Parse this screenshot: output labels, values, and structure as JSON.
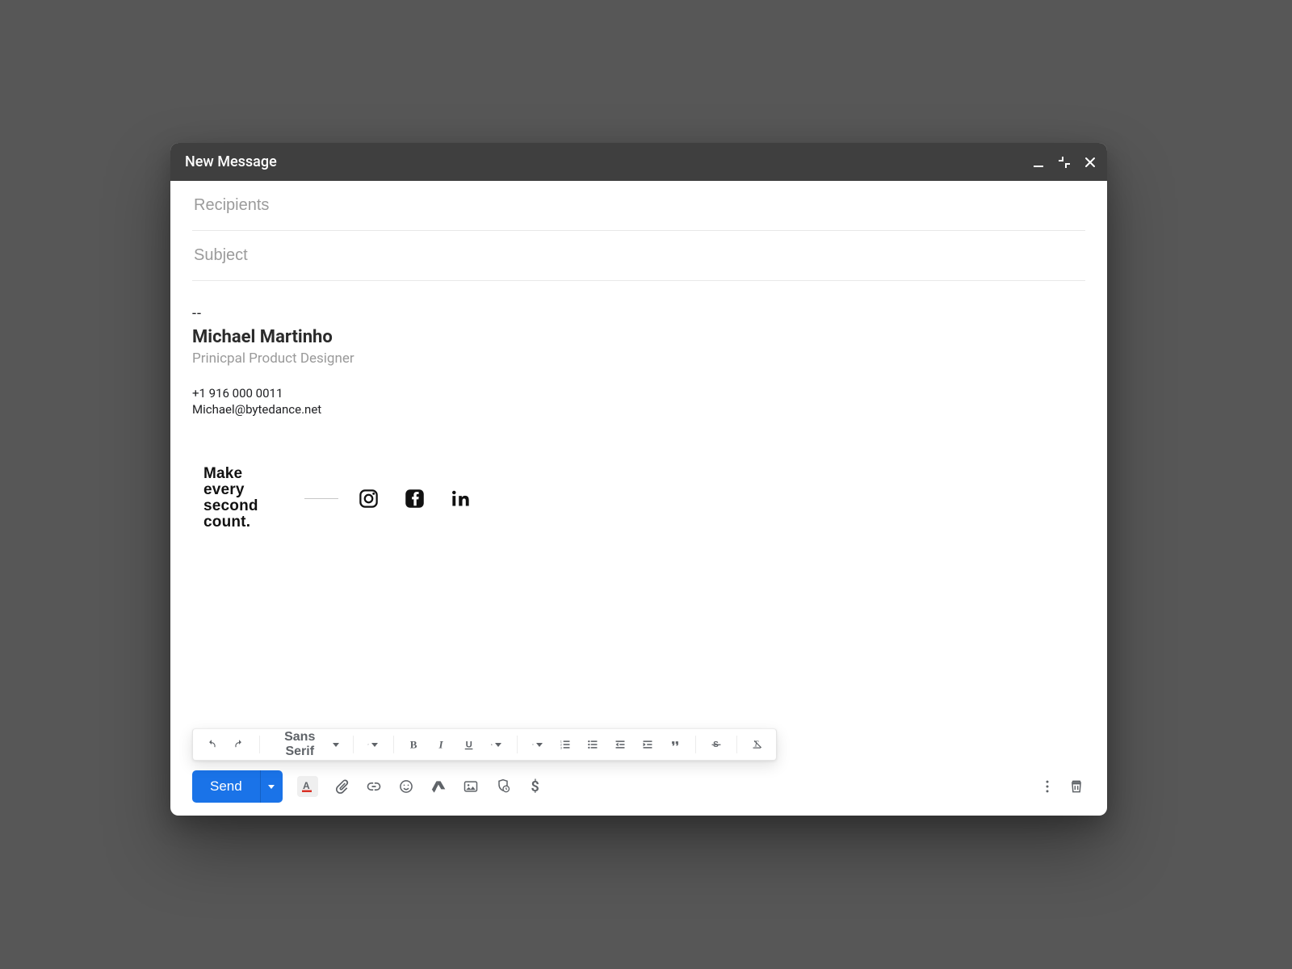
{
  "header": {
    "title": "New Message"
  },
  "fields": {
    "recipients_placeholder": "Recipients",
    "subject_placeholder": "Subject"
  },
  "signature": {
    "dashes": "--",
    "name": "Michael Martinho",
    "role": "Prinicpal Product Designer",
    "phone": "+1 916 000 0011",
    "email": "Michael@bytedance.net",
    "motto": "Make every second count."
  },
  "format_toolbar": {
    "font": "Sans Serif"
  },
  "send": {
    "label": "Send"
  }
}
